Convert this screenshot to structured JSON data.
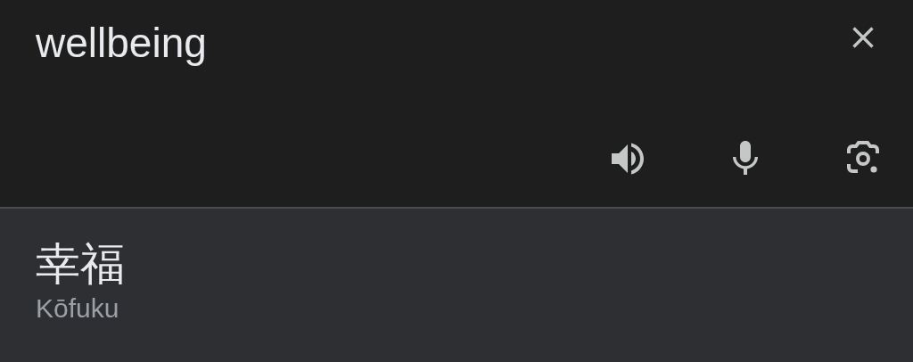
{
  "input": {
    "value": "wellbeing"
  },
  "result": {
    "text": "幸福",
    "romanization": "Kōfuku"
  }
}
